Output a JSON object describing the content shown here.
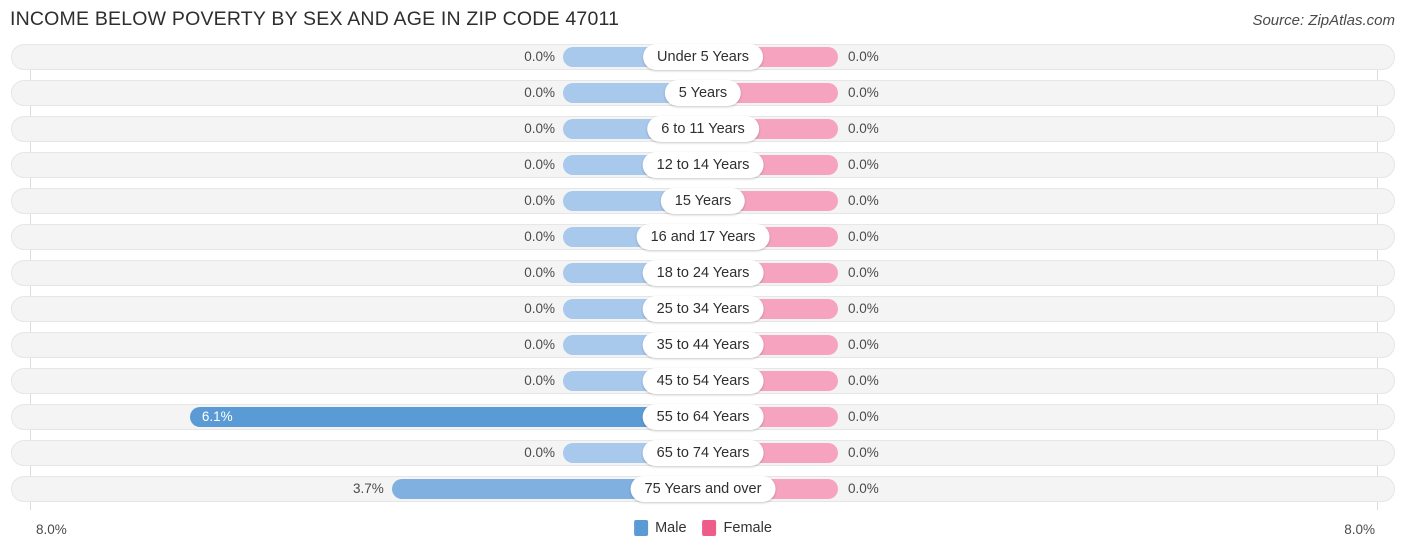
{
  "header": {
    "title": "Income Below Poverty by Sex and Age in Zip Code 47011",
    "source": "Source: ZipAtlas.com"
  },
  "axis": {
    "left_label": "8.0%",
    "right_label": "8.0%"
  },
  "legend": {
    "items": [
      {
        "label": "Male",
        "color": "#5b9bd5"
      },
      {
        "label": "Female",
        "color": "#ee5c8a"
      }
    ]
  },
  "chart_data": {
    "type": "bar",
    "title": "Income Below Poverty by Sex and Age in Zip Code 47011",
    "subtitle": "",
    "orientation": "horizontal-diverging",
    "xlabel": "",
    "ylabel": "",
    "xlim": [
      8.0,
      8.0
    ],
    "grid": true,
    "legend_position": "bottom-center",
    "categories": [
      "Under 5 Years",
      "5 Years",
      "6 to 11 Years",
      "12 to 14 Years",
      "15 Years",
      "16 and 17 Years",
      "18 to 24 Years",
      "25 to 34 Years",
      "35 to 44 Years",
      "45 to 54 Years",
      "55 to 64 Years",
      "65 to 74 Years",
      "75 Years and over"
    ],
    "series": [
      {
        "name": "Male",
        "color": "#5b9bd5",
        "values": [
          0.0,
          0.0,
          0.0,
          0.0,
          0.0,
          0.0,
          0.0,
          0.0,
          0.0,
          0.0,
          6.1,
          0.0,
          3.7
        ],
        "labels": [
          "0.0%",
          "0.0%",
          "0.0%",
          "0.0%",
          "0.0%",
          "0.0%",
          "0.0%",
          "0.0%",
          "0.0%",
          "0.0%",
          "6.1%",
          "0.0%",
          "3.7%"
        ]
      },
      {
        "name": "Female",
        "color": "#ee5c8a",
        "values": [
          0.0,
          0.0,
          0.0,
          0.0,
          0.0,
          0.0,
          0.0,
          0.0,
          0.0,
          0.0,
          0.0,
          0.0,
          0.0
        ],
        "labels": [
          "0.0%",
          "0.0%",
          "0.0%",
          "0.0%",
          "0.0%",
          "0.0%",
          "0.0%",
          "0.0%",
          "0.0%",
          "0.0%",
          "0.0%",
          "0.0%",
          "0.0%"
        ]
      }
    ]
  }
}
